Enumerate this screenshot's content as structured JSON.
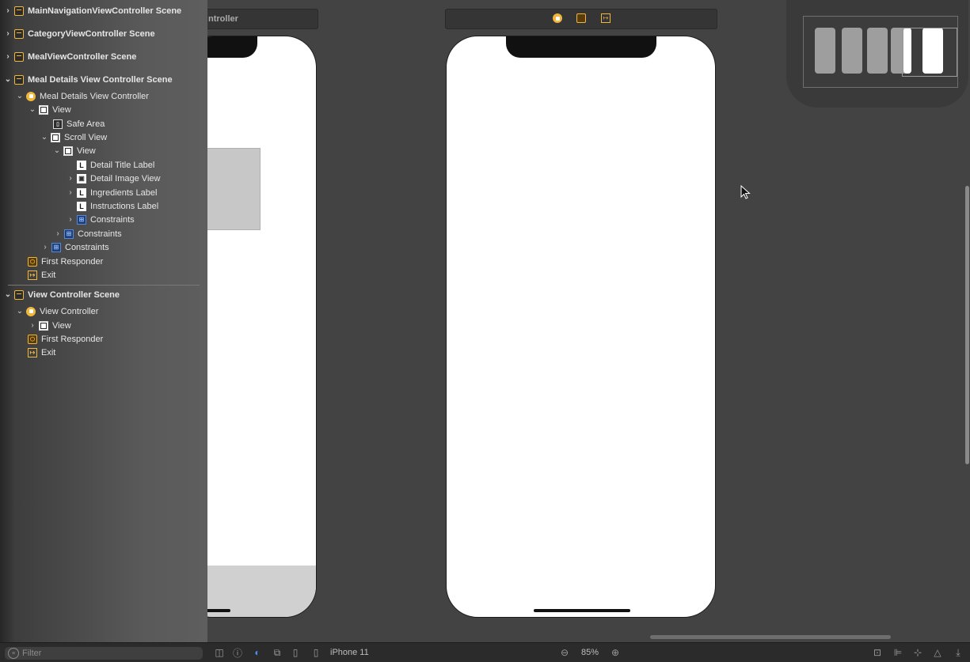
{
  "outline": {
    "scenes": [
      {
        "label": "MainNavigationViewController Scene"
      },
      {
        "label": "CategoryViewController Scene"
      },
      {
        "label": "MealViewController Scene"
      },
      {
        "label": "Meal Details View Controller Scene"
      },
      {
        "label": "View Controller Scene"
      }
    ],
    "meal_details": {
      "controller": "Meal Details View Controller",
      "view": "View",
      "safe_area": "Safe Area",
      "scroll_view": "Scroll View",
      "inner_view": "View",
      "detail_title_label": "Detail Title Label",
      "detail_image_view": "Detail Image View",
      "ingredients_label": "Ingredients Label",
      "instructions_label": "Instructions Label",
      "constraints_inner": "Constraints",
      "constraints_scroll": "Constraints",
      "constraints_view": "Constraints",
      "first_responder": "First Responder",
      "exit": "Exit"
    },
    "view_controller": {
      "controller": "View Controller",
      "view": "View",
      "first_responder": "First Responder",
      "exit": "Exit"
    }
  },
  "canvas": {
    "left_scene_title": "ntroller"
  },
  "bottom": {
    "filter_placeholder": "Filter",
    "device": "iPhone 11",
    "zoom": "85%"
  },
  "colors": {
    "accent": "#f0b73a",
    "constraint": "#5a86d6"
  }
}
